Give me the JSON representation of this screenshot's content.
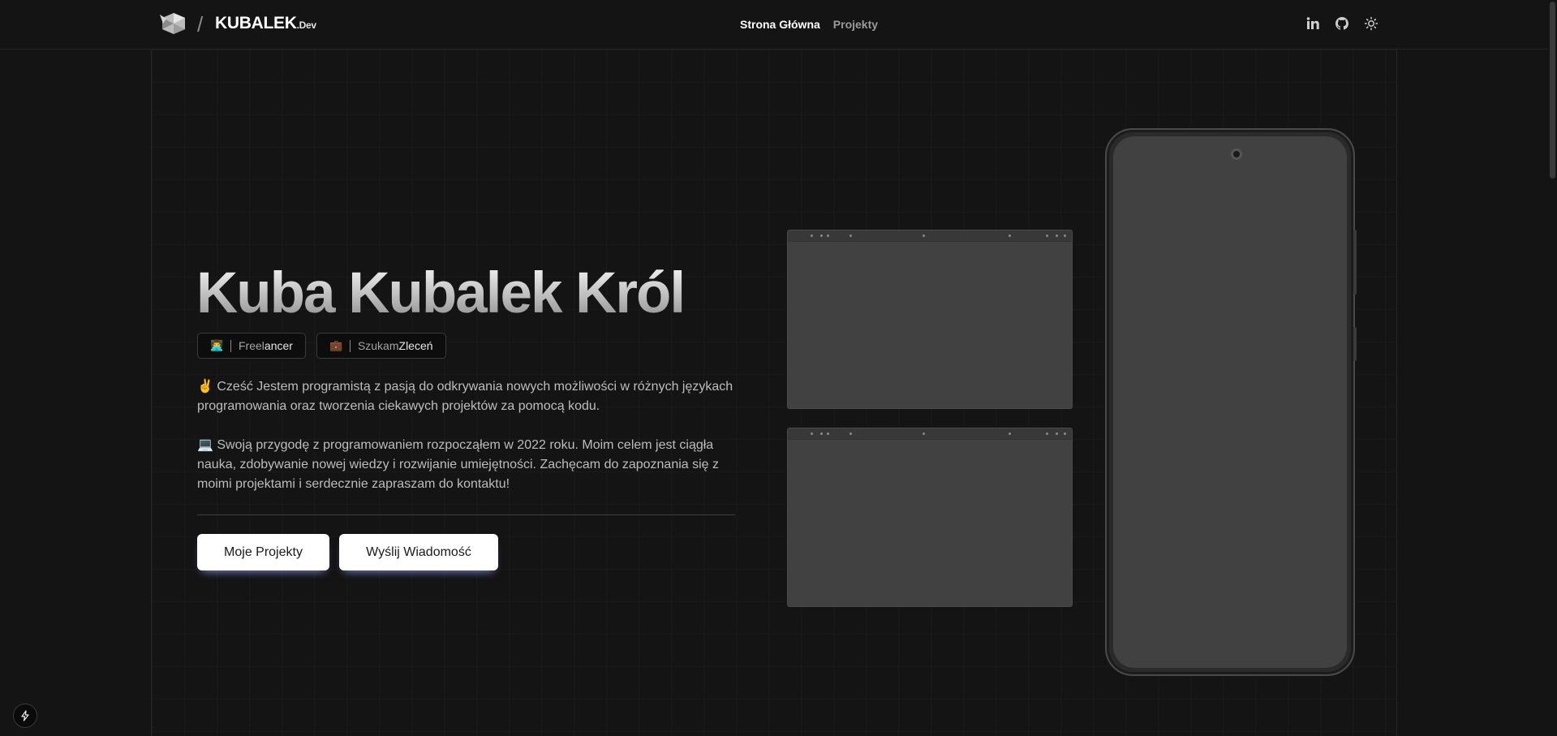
{
  "header": {
    "brand_name": "KUBALEK",
    "brand_tld": ".Dev",
    "slash": "/",
    "nav": [
      {
        "label": "Strona Główna",
        "active": true
      },
      {
        "label": "Projekty",
        "active": false
      }
    ],
    "icons": [
      "linkedin-icon",
      "github-icon",
      "sun-icon"
    ]
  },
  "hero": {
    "title": "Kuba Kubalek Król",
    "badges": [
      {
        "emoji": "👨‍💻",
        "dim": "Freel",
        "strong": "ancer"
      },
      {
        "emoji": "💼",
        "dim": "Szukam ",
        "strong": "Zleceń"
      }
    ],
    "paragraph_1": "✌️ Cześć Jestem programistą z pasją do odkrywania nowych możliwości w różnych językach programowania oraz tworzenia ciekawych projektów za pomocą kodu.",
    "paragraph_2": "💻 Swoją przygodę z programowaniem rozpocząłem w 2022 roku. Moim celem jest ciągła nauka, zdobywanie nowej wiedzy i rozwijanie umiejętności. Zachęcam do zapoznania się z moimi projektami i serdecznie zapraszam do kontaktu!",
    "primary_button": "Moje Projekty",
    "secondary_button": "Wyślij Wiadomość"
  },
  "colors": {
    "background": "#141414",
    "mock_screen": "#414141",
    "button_bg": "#ffffff"
  }
}
